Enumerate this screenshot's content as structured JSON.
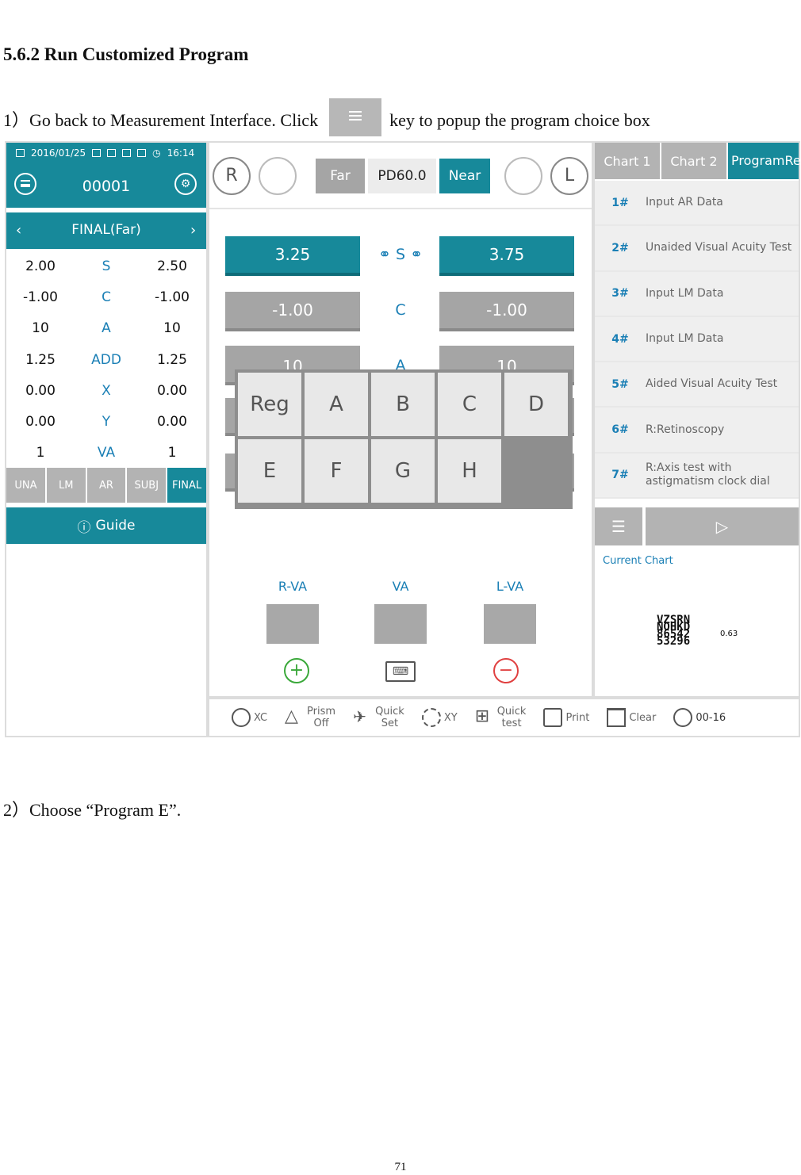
{
  "doc": {
    "heading": "5.6.2 Run Customized Program",
    "step1_before": "1）Go back to Measurement Interface. Click",
    "step1_after": "key to popup the program choice box",
    "step2": "2）Choose “Program E”.",
    "page_number": "71"
  },
  "left_panel": {
    "date": "2016/01/25",
    "time": "16:14",
    "patient_id": "00001",
    "mode_title": "FINAL(Far)",
    "rows": [
      {
        "right": "2.00",
        "label": "S",
        "left": "2.50"
      },
      {
        "right": "-1.00",
        "label": "C",
        "left": "-1.00"
      },
      {
        "right": "10",
        "label": "A",
        "left": "10"
      },
      {
        "right": "1.25",
        "label": "ADD",
        "left": "1.25"
      },
      {
        "right": "0.00",
        "label": "X",
        "left": "0.00"
      },
      {
        "right": "0.00",
        "label": "Y",
        "left": "0.00"
      },
      {
        "right": "1",
        "label": "VA",
        "left": "1"
      }
    ],
    "tabs": [
      "UNA",
      "LM",
      "AR",
      "SUBJ",
      "FINAL"
    ],
    "guide": "Guide"
  },
  "center_panel": {
    "r_label": "R",
    "l_label": "L",
    "far": "Far",
    "pd": "PD60.0",
    "near": "Near",
    "s_right": "3.25",
    "s_label": "S",
    "s_left": "3.75",
    "c_right": "-1.00",
    "c_label": "C",
    "c_left": "-1.00",
    "a_right": "10",
    "a_label": "A",
    "a_left": "10",
    "popup_keys": [
      "Reg",
      "A",
      "B",
      "C",
      "D",
      "E",
      "F",
      "G",
      "H"
    ],
    "rva": "R-VA",
    "va": "VA",
    "lva": "L-VA"
  },
  "right_panel": {
    "tabs": [
      "Chart 1",
      "Chart 2",
      "ProgramReg"
    ],
    "programs": [
      {
        "num": "1#",
        "name": "Input AR Data"
      },
      {
        "num": "2#",
        "name": "Unaided Visual Acuity Test"
      },
      {
        "num": "3#",
        "name": "Input LM Data"
      },
      {
        "num": "4#",
        "name": "Input LM Data"
      },
      {
        "num": "5#",
        "name": "Aided Visual Acuity Test"
      },
      {
        "num": "6#",
        "name": "R:Retinoscopy"
      },
      {
        "num": "7#",
        "name": "R:Axis test with astigmatism clock dial"
      }
    ],
    "current_chart": "Current Chart",
    "chart_lines": [
      "VZSRN",
      "NOHKD",
      "86542",
      "53296"
    ],
    "chart_size": "0.63"
  },
  "toolbar": {
    "xc": "XC",
    "prism": "Prism",
    "prism_off": "Off",
    "quick": "Quick",
    "set": "Set",
    "xy": "XY",
    "quick2": "Quick",
    "test": "test",
    "print": "Print",
    "clear": "Clear",
    "timer": "00-16"
  }
}
